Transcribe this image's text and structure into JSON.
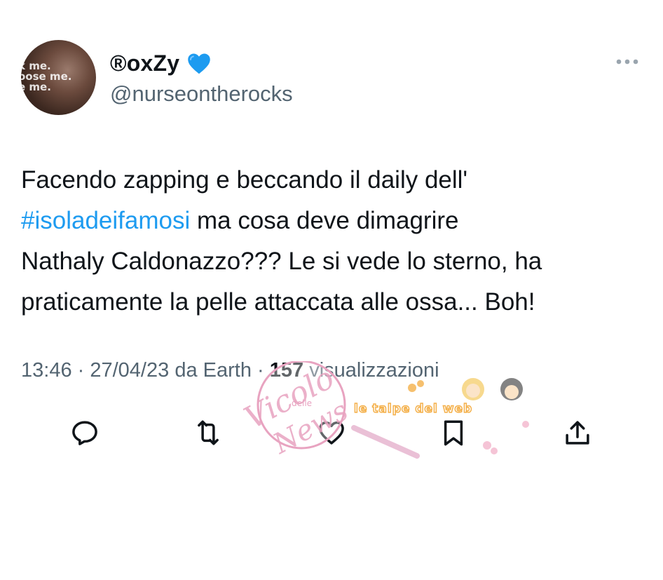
{
  "author": {
    "display_name": "®oxZy",
    "badge_icon": "blue-heart-icon",
    "handle": "@nurseontherocks",
    "avatar_text": [
      "k me.",
      "oose me.",
      "e me."
    ]
  },
  "tweet": {
    "lines": [
      "Facendo zapping e beccando il daily dell'",
      {
        "hashtag": "#isoladeifamosi",
        "rest": " ma cosa deve dimagrire"
      },
      "Nathaly Caldonazzo??? Le si vede lo sterno, ha",
      "praticamente la pelle attaccata alle ossa... Boh!"
    ]
  },
  "meta": {
    "time": "13:46",
    "date": "27/04/23",
    "source_prefix": "da",
    "source": "Earth",
    "views_count": "157",
    "views_label": "visualizzazioni"
  },
  "actions": [
    "reply-icon",
    "retweet-icon",
    "like-icon",
    "bookmark-icon",
    "share-icon"
  ],
  "watermark": {
    "title": "Vicolo",
    "middle": "delle",
    "bottom": "News",
    "brand": "le talpe del web"
  },
  "colors": {
    "text": "#0f1419",
    "secondary": "#536471",
    "hashtag": "#1d9bf0",
    "heart": "#1d9bf0",
    "watermark_pink": "#e8a3c0",
    "watermark_orange": "#f4b04a"
  }
}
